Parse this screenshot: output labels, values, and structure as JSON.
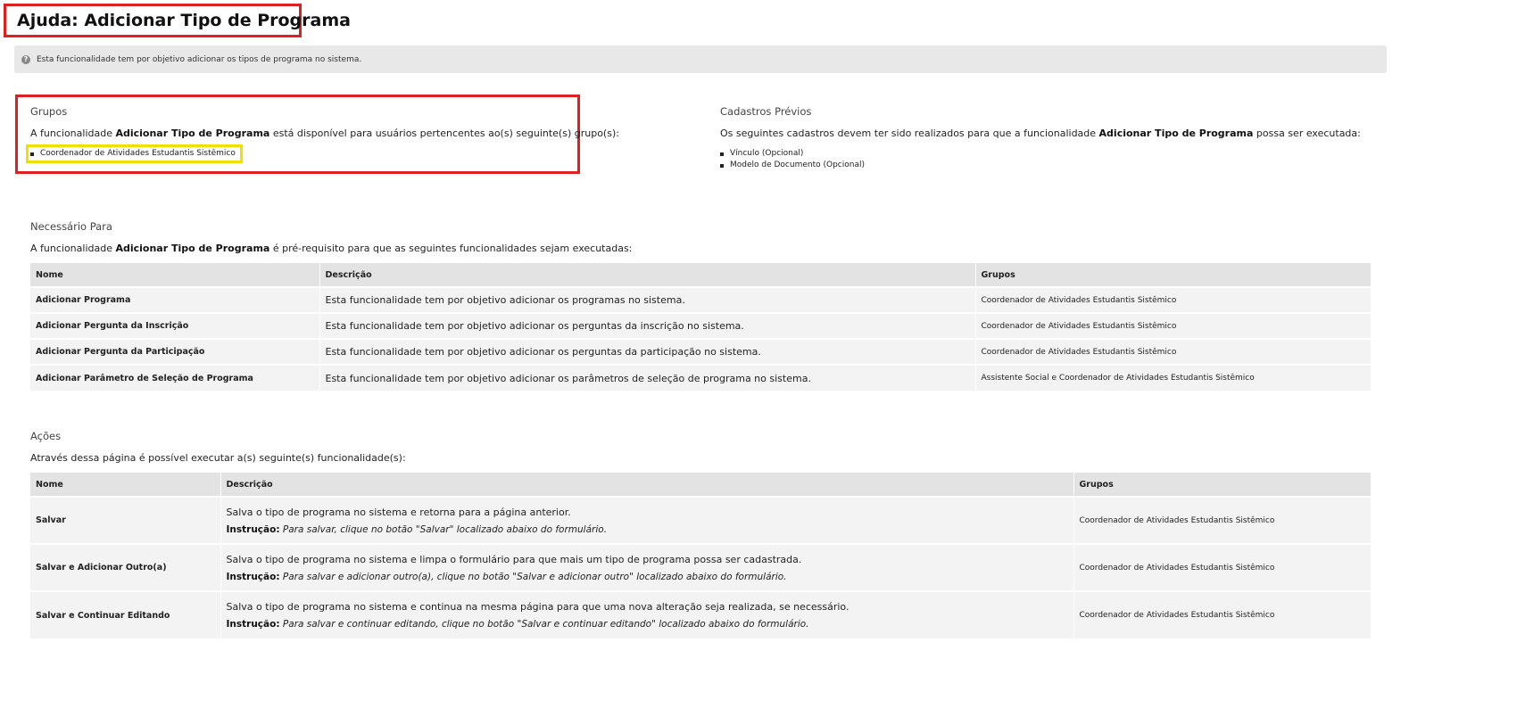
{
  "page": {
    "title": "Ajuda: Adicionar Tipo de Programa",
    "info": "Esta funcionalidade tem por objetivo adicionar os tipos de programa no sistema.",
    "help_icon": "question-circle-icon"
  },
  "groups": {
    "title": "Grupos",
    "text_prefix": "A funcionalidade ",
    "feature_name": "Adicionar Tipo de Programa",
    "text_suffix": " está disponível para usuários pertencentes ao(s) seguinte(s) grupo(s):",
    "items": [
      "Coordenador de Atividades Estudantis Sistêmico"
    ]
  },
  "prereq": {
    "title": "Cadastros Prévios",
    "text_prefix": "Os seguintes cadastros devem ter sido realizados para que a funcionalidade ",
    "feature_name": "Adicionar Tipo de Programa",
    "text_suffix": " possa ser executada:",
    "items": [
      "Vínculo (Opcional)",
      "Modelo de Documento (Opcional)"
    ]
  },
  "required_for": {
    "title": "Necessário Para",
    "text_prefix": "A funcionalidade ",
    "feature_name": "Adicionar Tipo de Programa",
    "text_suffix": " é pré-requisito para que as seguintes funcionalidades sejam executadas:",
    "columns": [
      "Nome",
      "Descrição",
      "Grupos"
    ],
    "rows": [
      {
        "name": "Adicionar Programa",
        "desc": "Esta funcionalidade tem por objetivo adicionar os programas no sistema.",
        "groups": "Coordenador de Atividades Estudantis Sistêmico"
      },
      {
        "name": "Adicionar Pergunta da Inscrição",
        "desc": "Esta funcionalidade tem por objetivo adicionar os perguntas da inscrição no sistema.",
        "groups": "Coordenador de Atividades Estudantis Sistêmico"
      },
      {
        "name": "Adicionar Pergunta da Participação",
        "desc": "Esta funcionalidade tem por objetivo adicionar os perguntas da participação no sistema.",
        "groups": "Coordenador de Atividades Estudantis Sistêmico"
      },
      {
        "name": "Adicionar Parâmetro de Seleção de Programa",
        "desc": "Esta funcionalidade tem por objetivo adicionar os parâmetros de seleção de programa no sistema.",
        "groups": "Assistente Social e Coordenador de Atividades Estudantis Sistêmico"
      }
    ]
  },
  "actions": {
    "title": "Ações",
    "text": "Através dessa página é possível executar a(s) seguinte(s) funcionalidade(s):",
    "columns": [
      "Nome",
      "Descrição",
      "Grupos"
    ],
    "instruction_label": "Instrução:",
    "rows": [
      {
        "name": "Salvar",
        "desc": "Salva o tipo de programa no sistema e retorna para a página anterior.",
        "instruction": "Para salvar, clique no botão \"Salvar\" localizado abaixo do formulário.",
        "groups": "Coordenador de Atividades Estudantis Sistêmico"
      },
      {
        "name": "Salvar e Adicionar Outro(a)",
        "desc": "Salva o tipo de programa no sistema e limpa o formulário para que mais um tipo de programa possa ser cadastrada.",
        "instruction": "Para salvar e adicionar outro(a), clique no botão \"Salvar e adicionar outro\" localizado abaixo do formulário.",
        "groups": "Coordenador de Atividades Estudantis Sistêmico"
      },
      {
        "name": "Salvar e Continuar Editando",
        "desc": "Salva o tipo de programa no sistema e continua na mesma página para que uma nova alteração seja realizada, se necessário.",
        "instruction": "Para salvar e continuar editando, clique no botão \"Salvar e continuar editando\" localizado abaixo do formulário.",
        "groups": "Coordenador de Atividades Estudantis Sistêmico"
      }
    ]
  },
  "colors": {
    "annotation_red": "#e02020",
    "annotation_yellow": "#f0e000",
    "link_green": "#1f8a6f"
  }
}
